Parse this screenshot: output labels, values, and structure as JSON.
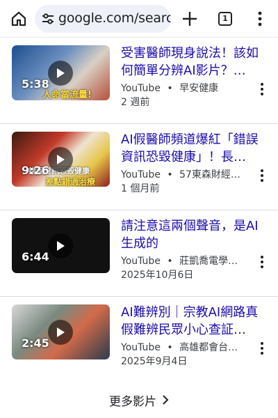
{
  "browser": {
    "url": "google.com/search",
    "tab_count": "1"
  },
  "videos": [
    {
      "title": "受害醫師現身說法！該如何簡單分辨AI影片？…",
      "source": "YouTube",
      "channel": "早安健康",
      "date": "2 週前",
      "duration": "5:38"
    },
    {
      "title": "AI假醫師頻道爆紅「錯誤資訊恐毀健康」！長…",
      "source": "YouTube",
      "channel": "57東森財經…",
      "date": "1 個月前",
      "duration": "9:26"
    },
    {
      "title": "請注意這兩個聲音，是AI生成的",
      "source": "YouTube",
      "channel": "莊凱喬電學…",
      "date": "2025年10月6日",
      "duration": "6:44"
    },
    {
      "title": "AI難辨別｜宗教AI網路真假難辨民眾小心查証…",
      "source": "YouTube",
      "channel": "高雄都會台…",
      "date": "2025年9月4日",
      "duration": "2:45"
    }
  ],
  "more_videos_label": "更多影片",
  "meta_separator": "•",
  "colors": {
    "link": "#1a0dab",
    "text": "#202124",
    "meta": "#3c4043",
    "omnibox": "#eef1f8"
  }
}
